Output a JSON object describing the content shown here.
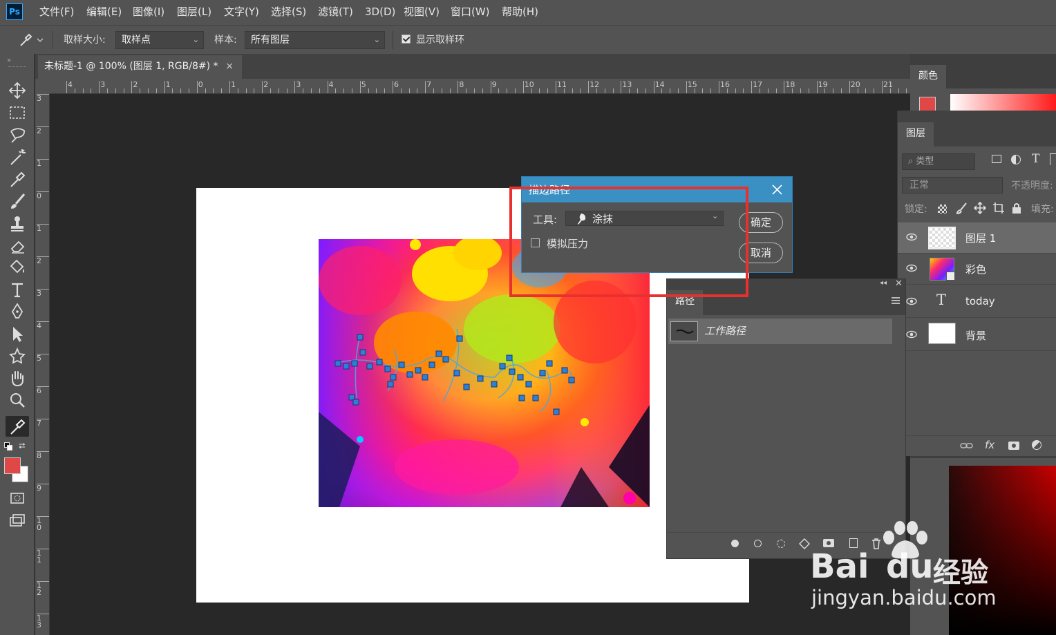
{
  "app": {
    "logo": "Ps"
  },
  "menu": [
    "文件(F)",
    "编辑(E)",
    "图像(I)",
    "图层(L)",
    "文字(Y)",
    "选择(S)",
    "滤镜(T)",
    "3D(D)",
    "视图(V)",
    "窗口(W)",
    "帮助(H)"
  ],
  "options": {
    "sample_size_label": "取样大小:",
    "sample_size_value": "取样点",
    "sample_label": "样本:",
    "sample_value": "所有图层",
    "show_ring_label": "显示取样环",
    "show_ring_checked": true
  },
  "document_tab": {
    "title": "未标题-1 @ 100% (图层 1, RGB/8#) *",
    "close": "×"
  },
  "ruler": {
    "h_labels": [
      "4",
      "3",
      "2",
      "1",
      "0",
      "1",
      "2",
      "3",
      "4",
      "5",
      "6",
      "7",
      "8",
      "9",
      "10",
      "11",
      "12",
      "13",
      "14",
      "15",
      "16",
      "17",
      "18",
      "19",
      "20",
      "21"
    ],
    "v_labels": [
      "3",
      "2",
      "1",
      "0",
      "1",
      "2",
      "3",
      "4",
      "5",
      "6",
      "7",
      "8",
      "9",
      "10",
      "11",
      "12",
      "13"
    ]
  },
  "tools": [
    "move-icon",
    "marquee-icon",
    "lasso-icon",
    "magic-wand-icon",
    "eyedropper-icon",
    "brush-icon",
    "stamp-icon",
    "eraser-icon",
    "paint-bucket-icon",
    "type-icon",
    "pen-icon",
    "path-select-icon",
    "shape-icon",
    "hand-icon",
    "zoom-icon",
    "color-sampler-icon"
  ],
  "colors": {
    "foreground": "#e04848",
    "background": "#ffffff",
    "accent": "#3a90c2",
    "highlight": "#e8302f"
  },
  "color_panel": {
    "tab": "颜色"
  },
  "layers_panel": {
    "tab": "图层",
    "filter_placeholder": "类型",
    "blend_mode": "正常",
    "opacity_label": "不透明度:",
    "lock_label": "锁定:",
    "fill_label": "填充:",
    "layers": [
      {
        "name": "图层 1",
        "type": "transparent",
        "active": true
      },
      {
        "name": "彩色",
        "type": "smart-object",
        "active": false
      },
      {
        "name": "today",
        "type": "text",
        "active": false
      },
      {
        "name": "背景",
        "type": "white",
        "active": false
      }
    ],
    "type_glyph": "T",
    "fx_label": "fx"
  },
  "paths_panel": {
    "tab": "路径",
    "paths": [
      {
        "name": "工作路径"
      }
    ]
  },
  "stroke_dialog": {
    "title": "描边路径",
    "tool_label": "工具:",
    "tool_value": "涂抹",
    "simulate_pressure_label": "模拟压力",
    "simulate_pressure_checked": false,
    "ok_label": "确定",
    "cancel_label": "取消"
  },
  "watermark": {
    "brand": "Bai",
    "brand_du": "du",
    "brand_cn": "经验",
    "url": "jingyan.baidu.com"
  }
}
